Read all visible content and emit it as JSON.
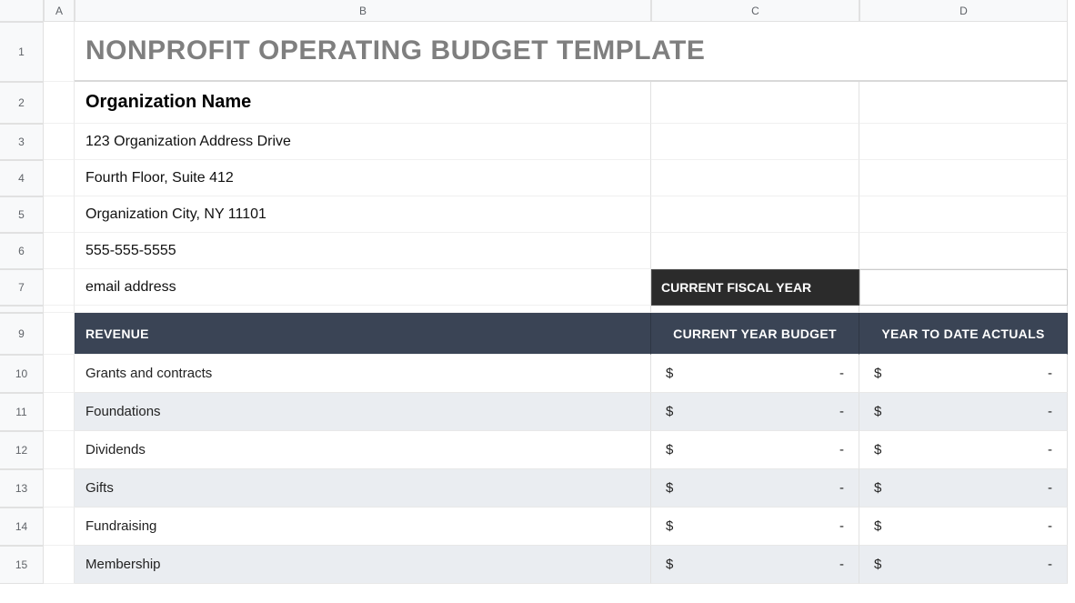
{
  "columns": [
    "A",
    "B",
    "C",
    "D"
  ],
  "rowNumbers": [
    "1",
    "2",
    "3",
    "4",
    "5",
    "6",
    "7",
    "",
    "9",
    "10",
    "11",
    "12",
    "13",
    "14",
    "15"
  ],
  "title": "NONPROFIT OPERATING BUDGET TEMPLATE",
  "org": {
    "name": "Organization Name",
    "addr1": "123 Organization Address Drive",
    "addr2": "Fourth Floor, Suite 412",
    "cityline": "Organization City, NY  11101",
    "phone": "555-555-5555",
    "email": "email address"
  },
  "fiscal": {
    "label": "CURRENT FISCAL YEAR",
    "value": ""
  },
  "headers": {
    "revenue": "REVENUE",
    "budget": "CURRENT YEAR BUDGET",
    "actuals": "YEAR TO DATE ACTUALS"
  },
  "currency": "$",
  "dash": "-",
  "rows": [
    {
      "label": "Grants and contracts",
      "budget": "-",
      "actuals": "-"
    },
    {
      "label": "Foundations",
      "budget": "-",
      "actuals": "-"
    },
    {
      "label": "Dividends",
      "budget": "-",
      "actuals": "-"
    },
    {
      "label": "Gifts",
      "budget": "-",
      "actuals": "-"
    },
    {
      "label": "Fundraising",
      "budget": "-",
      "actuals": "-"
    },
    {
      "label": "Membership",
      "budget": "-",
      "actuals": "-"
    }
  ]
}
